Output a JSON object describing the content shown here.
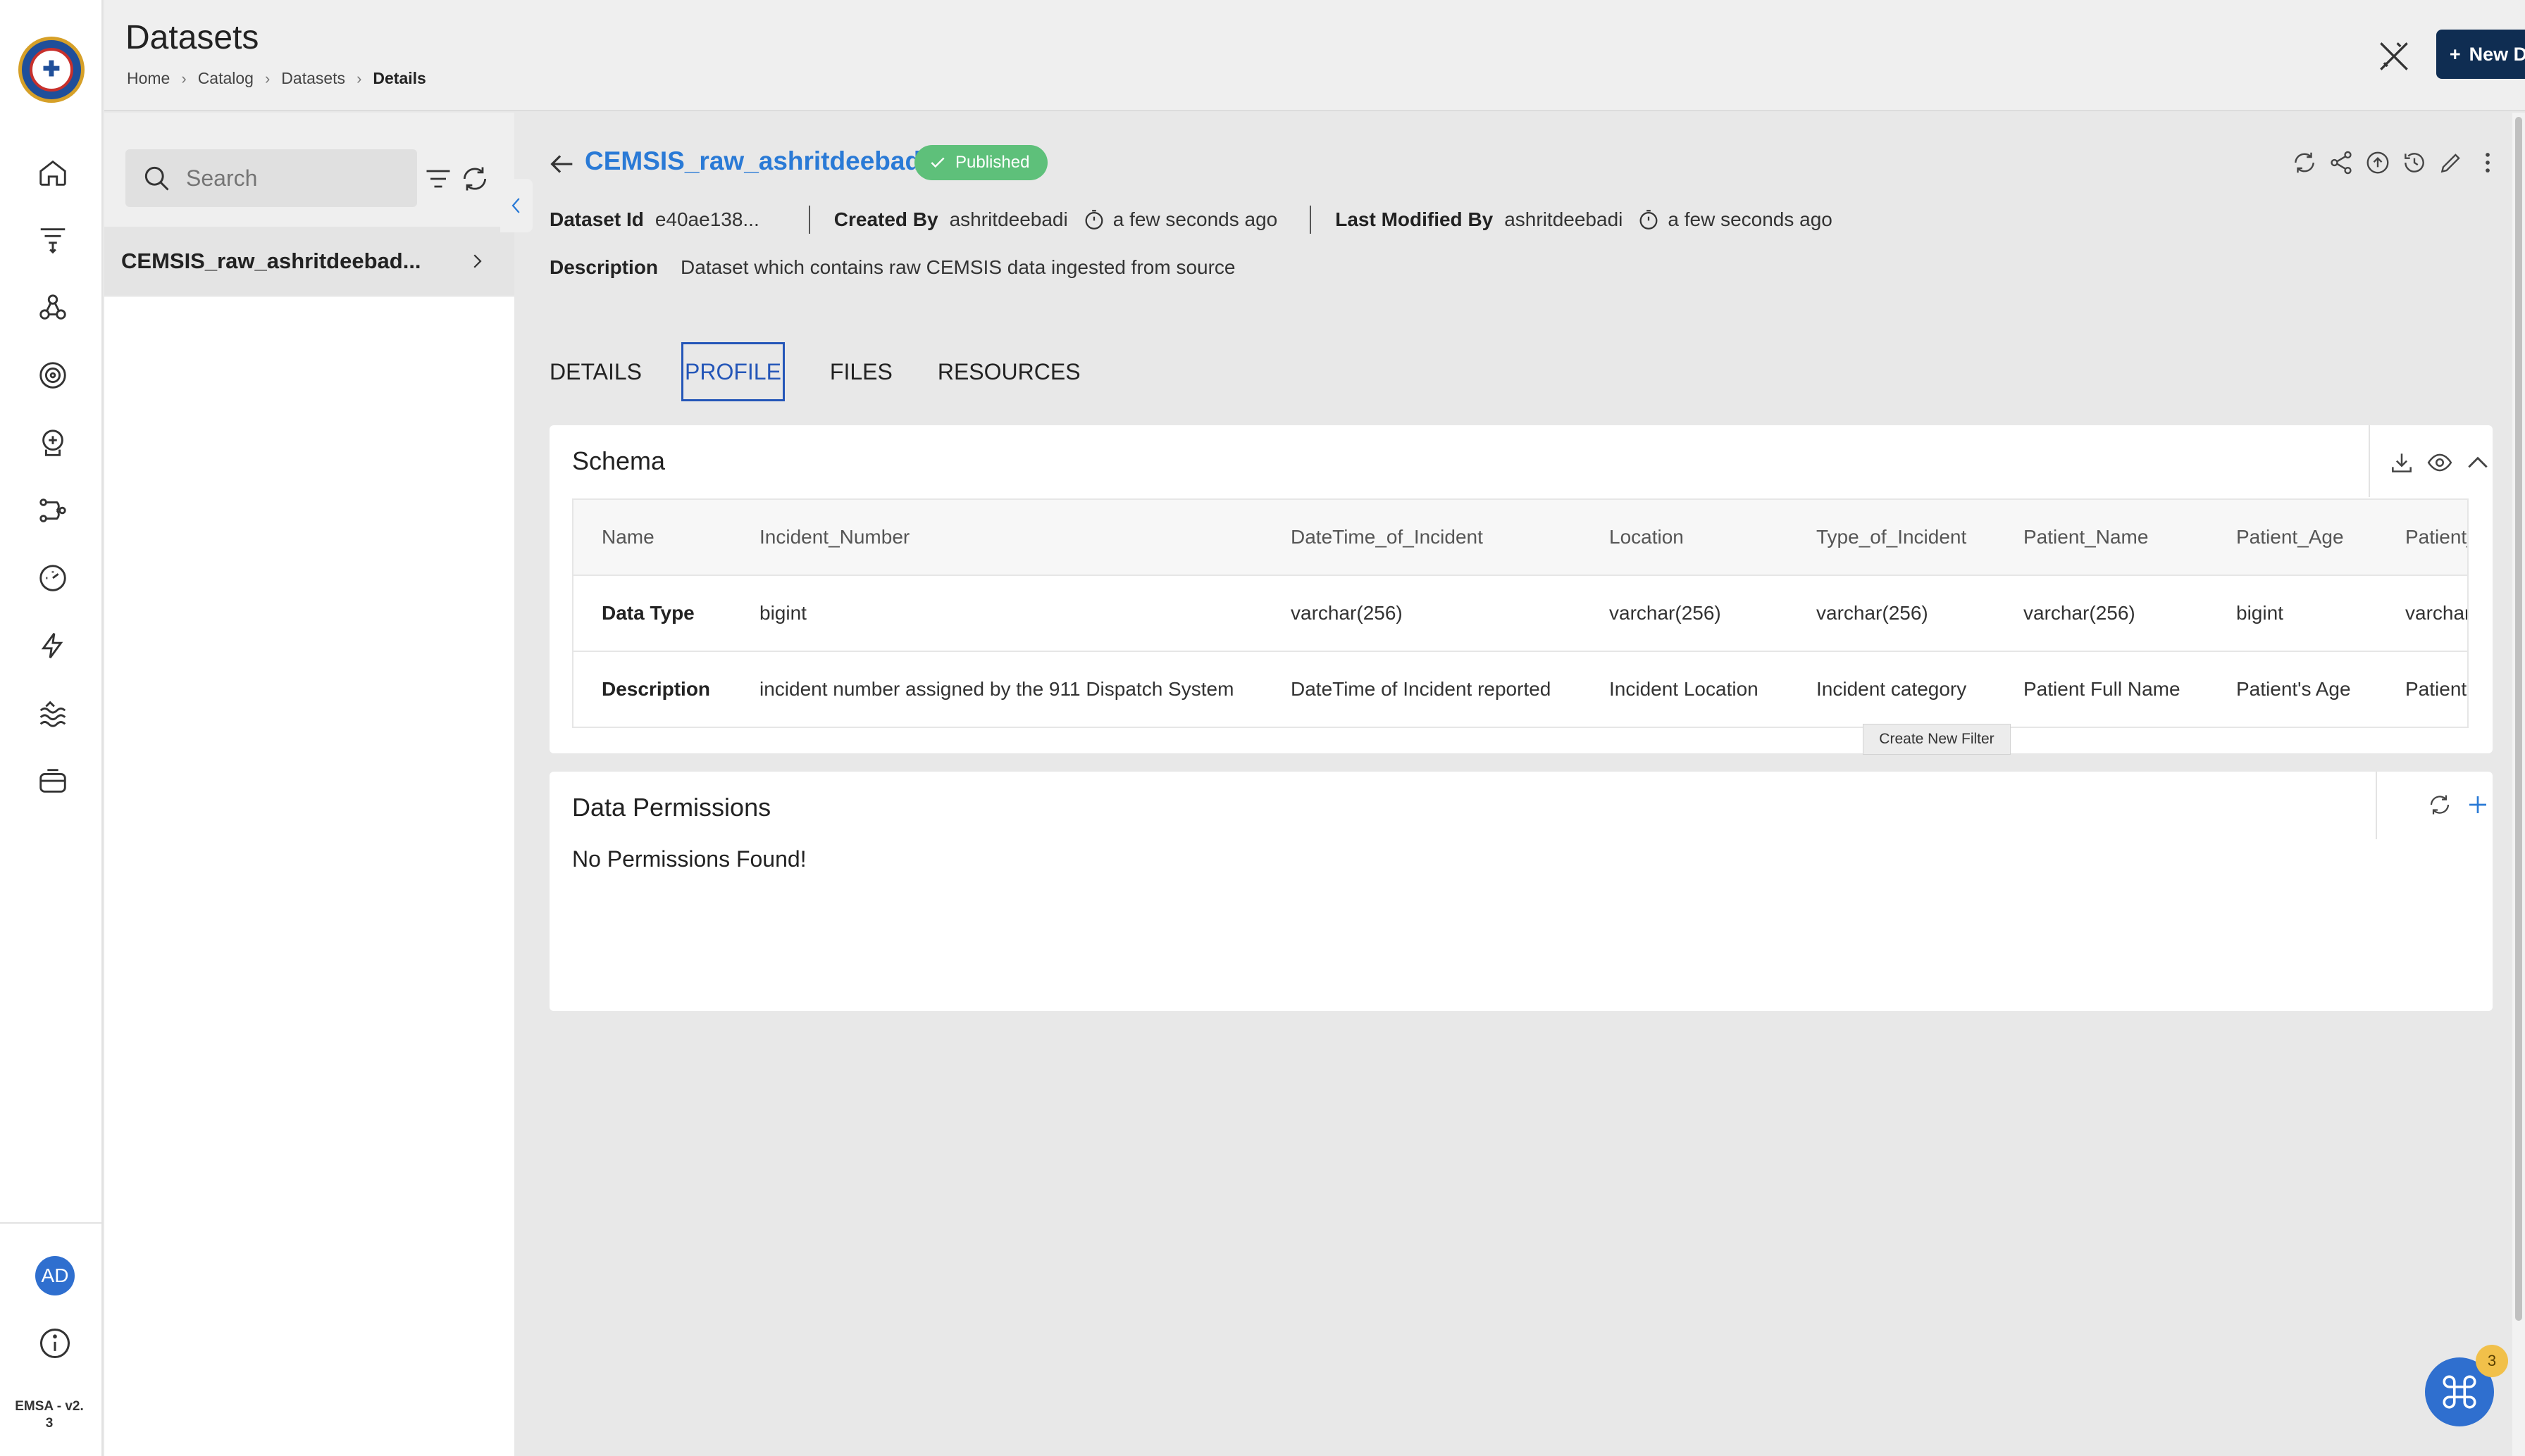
{
  "header": {
    "title": "Datasets",
    "breadcrumb": [
      "Home",
      "Catalog",
      "Datasets",
      "Details"
    ],
    "new_dataset_label": "New Dataset"
  },
  "sidebar": {
    "version": "EMSA - v2.\n3",
    "avatar_initials": "AD",
    "icons": [
      "home-icon",
      "filter-funnel-icon",
      "molecule-icon",
      "settings-target-icon",
      "brain-head-icon",
      "pipeline-flow-icon",
      "gauge-icon",
      "lightning-icon",
      "water-waves-icon",
      "storage-box-icon"
    ]
  },
  "dataset_list": {
    "search_placeholder": "Search",
    "items": [
      {
        "label": "CEMSIS_raw_ashritdeebad..."
      }
    ]
  },
  "dataset": {
    "name": "CEMSIS_raw_ashritdeebadi",
    "status": "Published",
    "id_label": "Dataset Id",
    "id_value": "e40ae138...",
    "created_by_label": "Created By",
    "created_by_value": "ashritdeebadi",
    "created_time": "a few seconds ago",
    "modified_by_label": "Last Modified By",
    "modified_by_value": "ashritdeebadi",
    "modified_time": "a few seconds ago",
    "description_label": "Description",
    "description_value": "Dataset which contains raw CEMSIS data ingested from source"
  },
  "tabs": [
    {
      "label": "DETAILS"
    },
    {
      "label": "PROFILE",
      "active": true
    },
    {
      "label": "FILES"
    },
    {
      "label": "RESOURCES"
    }
  ],
  "schema": {
    "title": "Schema",
    "header": [
      "Name",
      "Incident_Number",
      "DateTime_of_Incident",
      "Location",
      "Type_of_Incident",
      "Patient_Name",
      "Patient_Age",
      "Patient_"
    ],
    "rows": [
      [
        "Data Type",
        "bigint",
        "varchar(256)",
        "varchar(256)",
        "varchar(256)",
        "varchar(256)",
        "bigint",
        "varchar"
      ],
      [
        "Description",
        "incident number assigned by the 911 Dispatch System",
        "DateTime of Incident reported",
        "Incident Location",
        "Incident category",
        "Patient Full Name",
        "Patient's Age",
        "Patient"
      ]
    ]
  },
  "permissions": {
    "title": "Data Permissions",
    "empty_text": "No Permissions Found!",
    "tooltip": "Create New Filter"
  },
  "fab": {
    "badge": "3"
  },
  "colors": {
    "accent": "#2a7ad6",
    "primary_button": "#0f2d52",
    "published": "#5ec07a",
    "badge": "#f1c04a"
  }
}
